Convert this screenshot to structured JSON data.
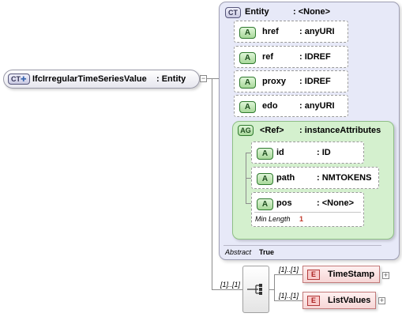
{
  "root": {
    "badge": "CT",
    "name": "IfcIrregularTimeSeriesValue",
    "type": ": Entity"
  },
  "complex_type": {
    "badge": "CT",
    "name": "Entity",
    "type": ": <None>",
    "abstract_label": "Abstract",
    "abstract_value": "True"
  },
  "attributes": [
    {
      "badge": "A",
      "name": "href",
      "type": ": anyURI"
    },
    {
      "badge": "A",
      "name": "ref",
      "type": ": IDREF"
    },
    {
      "badge": "A",
      "name": "proxy",
      "type": ": IDREF"
    },
    {
      "badge": "A",
      "name": "edo",
      "type": ": anyURI"
    }
  ],
  "attribute_group": {
    "badge": "AG",
    "name": "<Ref>",
    "type": ": instanceAttributes",
    "attributes": [
      {
        "badge": "A",
        "name": "id",
        "type": ": ID"
      },
      {
        "badge": "A",
        "name": "path",
        "type": ": NMTOKENS"
      },
      {
        "badge": "A",
        "name": "pos",
        "type": ": <None>",
        "facet_label": "Min Length",
        "facet_value": "1"
      }
    ]
  },
  "sequence": {
    "multiplicity": "[1]..[1]"
  },
  "elements": [
    {
      "badge": "E",
      "name": "TimeStamp",
      "multiplicity": "[1]..[1]"
    },
    {
      "badge": "E",
      "name": "ListValues",
      "multiplicity": "[1]..[1]"
    }
  ],
  "colors": {
    "complex_type_fill": "#e7e9f8",
    "attribute_group_fill": "#d4f0ce",
    "element_fill": "#f6d6d6",
    "attribute_badge": "#a8d89a"
  }
}
